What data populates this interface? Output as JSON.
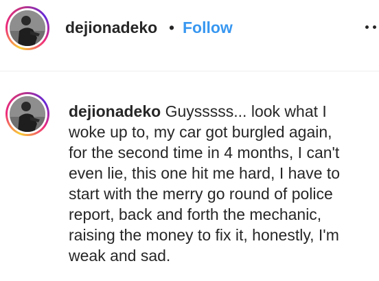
{
  "header": {
    "username": "dejionadeko",
    "separator": "•",
    "follow_label": "Follow",
    "more_icon": "more-options-icon"
  },
  "comment": {
    "username": "dejionadeko",
    "lines": [
      "Guysssss... look what I",
      "woke up to, my car got burgled again,",
      "for the second time in 4 months, I can't",
      "even lie, this one hit me hard, I have to",
      "start with the merry go round of police",
      "report, back and forth the mechanic,",
      "raising the money to fix it, honestly, I'm",
      "weak and sad."
    ]
  },
  "colors": {
    "follow": "#3897f0",
    "text": "#262626",
    "divider": "#efefef"
  }
}
